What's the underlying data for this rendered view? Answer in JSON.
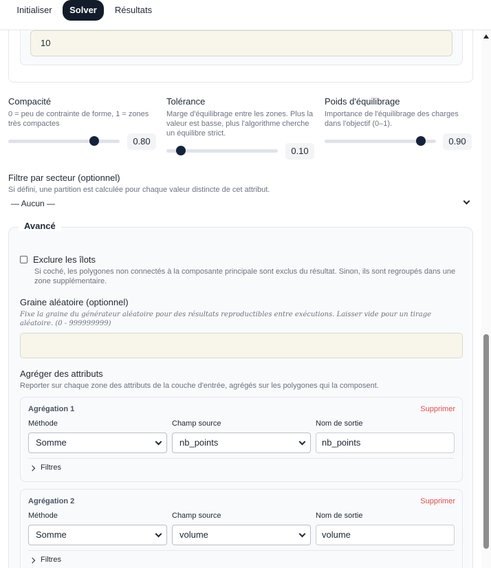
{
  "nav": {
    "tabs": [
      {
        "label": "Initialiser"
      },
      {
        "label": "Solver"
      },
      {
        "label": "Résultats"
      }
    ],
    "active": "Solver"
  },
  "prev_section": {
    "value": "10"
  },
  "params": [
    {
      "label": "Compacité",
      "description": "0 = peu de contrainte de forme, 1 = zones très compactes",
      "value": "0.80",
      "level": 0.8
    },
    {
      "label": "Tolérance",
      "description": "Marge d'équilibrage entre les zones. Plus la valeur est basse, plus l'algorithme cherche un équilibre strict.",
      "value": "0.10",
      "level": 0.1
    },
    {
      "label": "Poids d'équilibrage",
      "description": "Importance de l'équilibrage des charges dans l'objectif (0–1).",
      "value": "0.90",
      "level": 0.9
    }
  ],
  "filter": {
    "title": "Filtre par secteur (optionnel)",
    "description": "Si défini, une partition est calculée pour chaque valeur distincte de cet attribut.",
    "selected": "— Aucun —"
  },
  "advanced": {
    "legend": "Avancé",
    "exclude_islands": {
      "label": "Exclure les îlots",
      "checked": false,
      "description": "Si coché, les polygones non connectés à la composante principale sont exclus du résultat. Sinon, ils sont regroupés dans une zone supplémentaire."
    },
    "seed": {
      "title": "Graine aléatoire (optionnel)",
      "description": "Fixe la graine du générateur aléatoire pour des résultats reproductibles entre exécutions. Laisser vide pour un tirage aléatoire. (0 - 999999999)",
      "value": ""
    },
    "aggregate": {
      "title": "Agréger des attributs",
      "description": "Reporter sur chaque zone des attributs de la couche d'entrée, agrégés sur les polygones qui la composent.",
      "col_method": "Méthode",
      "col_source": "Champ source",
      "col_output": "Nom de sortie",
      "delete_label": "Supprimer",
      "filters_label": "Filtres",
      "items": [
        {
          "name": "Agrégation 1",
          "method": "Somme",
          "source": "nb_points",
          "output": "nb_points"
        },
        {
          "name": "Agrégation 2",
          "method": "Somme",
          "source": "volume",
          "output": "volume"
        }
      ]
    }
  },
  "colors": {
    "active_tab": "#131c2b",
    "slider_knob": "#15233a",
    "delete": "#e24b4b",
    "input_fill": "#f8f6eb"
  }
}
